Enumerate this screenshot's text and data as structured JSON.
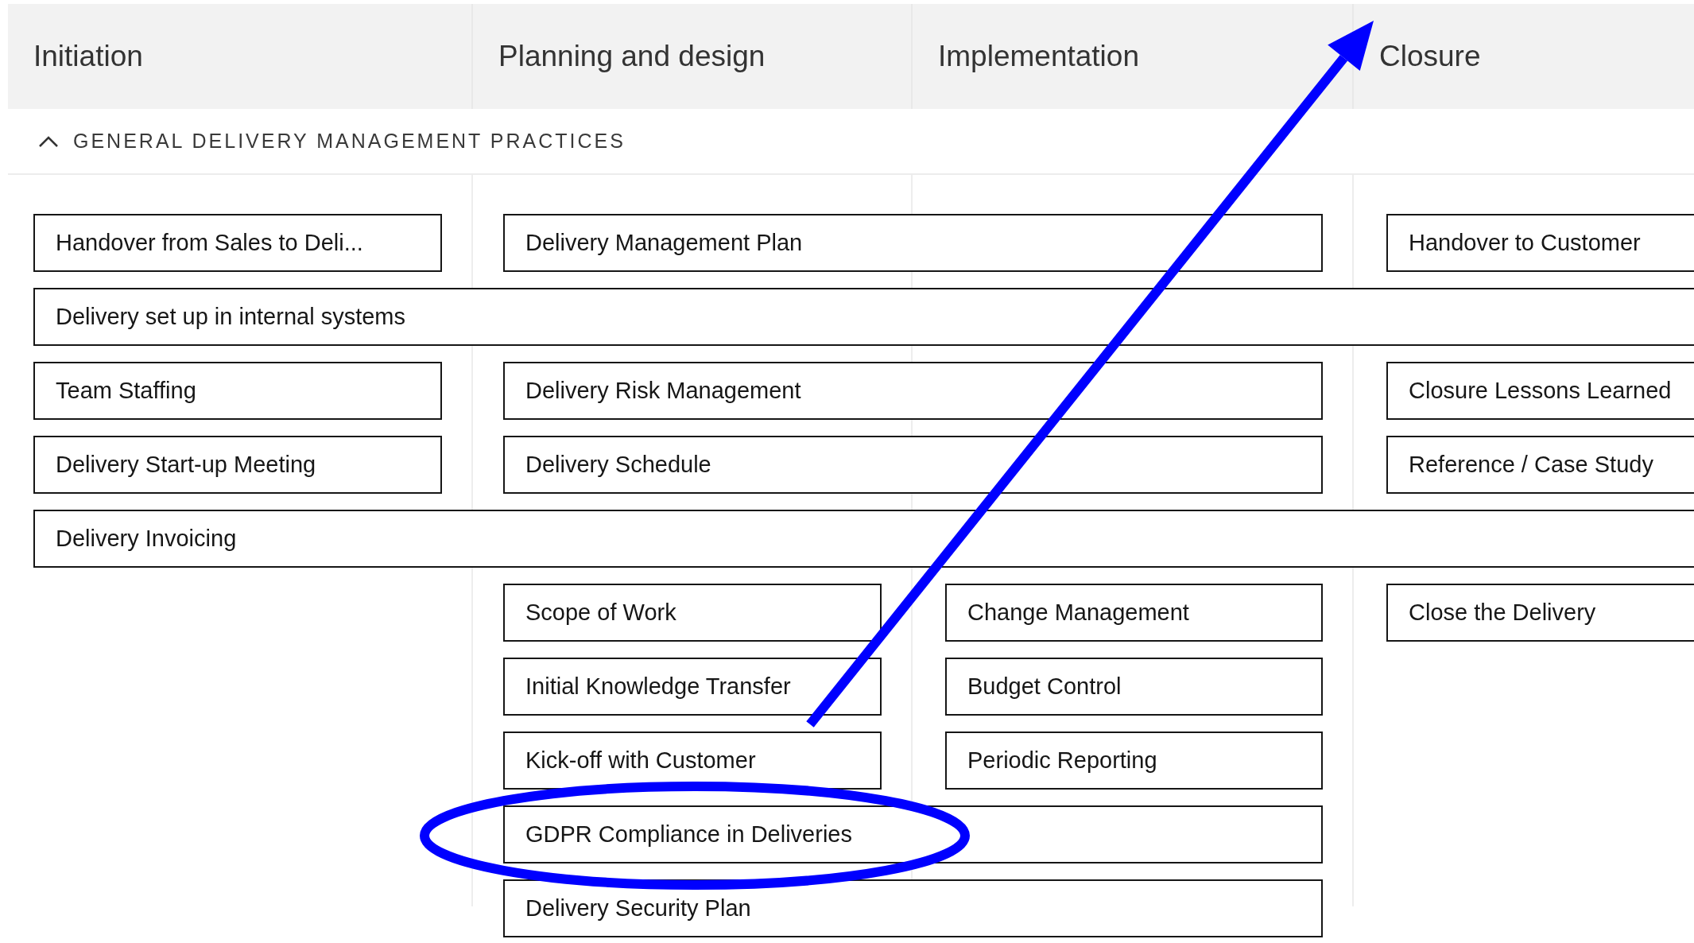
{
  "phases": [
    "Initiation",
    "Planning and design",
    "Implementation",
    "Closure"
  ],
  "section": {
    "title": "GENERAL DELIVERY MANAGEMENT PRACTICES",
    "expanded": true
  },
  "rows": [
    {
      "cells": [
        {
          "label": "Handover from Sales to Deli...",
          "kind": "single"
        },
        {
          "label": "Delivery Management Plan",
          "kind": "wide"
        },
        {
          "label": "Handover to Customer",
          "kind": "single"
        }
      ]
    },
    {
      "cells": [
        {
          "label": "Delivery set up in internal systems",
          "kind": "full"
        }
      ]
    },
    {
      "cells": [
        {
          "label": "Team Staffing",
          "kind": "single"
        },
        {
          "label": "Delivery Risk Management",
          "kind": "wide"
        },
        {
          "label": "Closure Lessons Learned",
          "kind": "single"
        }
      ]
    },
    {
      "cells": [
        {
          "label": "Delivery Start-up Meeting",
          "kind": "single"
        },
        {
          "label": "Delivery Schedule",
          "kind": "wide"
        },
        {
          "label": "Reference / Case Study",
          "kind": "single"
        }
      ]
    },
    {
      "cells": [
        {
          "label": "Delivery Invoicing",
          "kind": "full"
        }
      ]
    },
    {
      "cells": [
        null,
        {
          "label": "Scope of Work",
          "kind": "single"
        },
        {
          "label": "Change Management",
          "kind": "single"
        },
        {
          "label": "Close the Delivery",
          "kind": "single"
        }
      ]
    },
    {
      "cells": [
        null,
        {
          "label": "Initial Knowledge Transfer",
          "kind": "single"
        },
        {
          "label": "Budget Control",
          "kind": "single"
        }
      ]
    },
    {
      "cells": [
        null,
        {
          "label": "Kick-off with Customer",
          "kind": "single"
        },
        {
          "label": "Periodic Reporting",
          "kind": "single"
        }
      ]
    },
    {
      "cells": [
        null,
        {
          "label": "GDPR Compliance in Deliveries",
          "kind": "wide"
        }
      ]
    },
    {
      "cells": [
        null,
        {
          "label": "Delivery Security Plan",
          "kind": "wide"
        }
      ]
    }
  ],
  "annotations": [
    {
      "kind": "arrow"
    },
    {
      "kind": "ellipse"
    }
  ]
}
